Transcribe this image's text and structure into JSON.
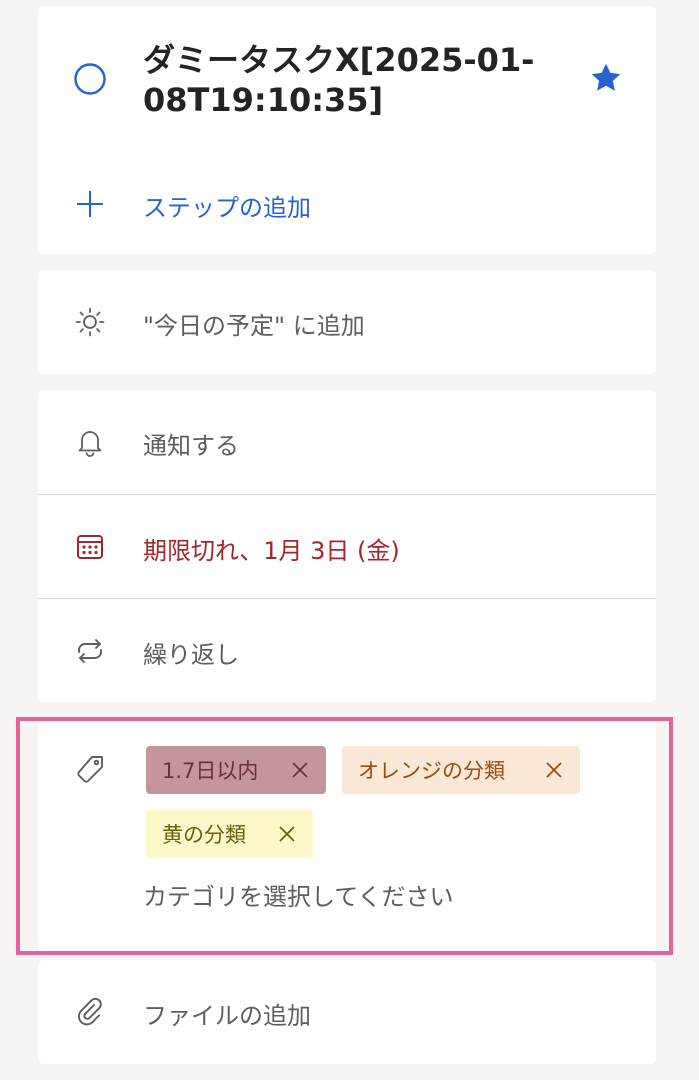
{
  "task": {
    "title": "ダミータスクX[2025-01-08T19:10:35]",
    "title_line1": "ダミータスクX[2025-01-",
    "title_line2": "08T19:10:35]",
    "add_step_label": "ステップの追加"
  },
  "my_day": {
    "label": "\"今日の予定\" に追加"
  },
  "details": {
    "remind_label": "通知する",
    "due_label": "期限切れ、1月 3日 (金)",
    "repeat_label": "繰り返し"
  },
  "categories": {
    "chips": [
      {
        "label": "1.7日以内",
        "bg": "#c4959c",
        "fg": "#6b2f37"
      },
      {
        "label": "オレンジの分類",
        "bg": "#fbe8d6",
        "fg": "#a04a10"
      },
      {
        "label": "黄の分類",
        "bg": "#fdf8c8",
        "fg": "#6b5e10"
      }
    ],
    "placeholder": "カテゴリを選択してください"
  },
  "file": {
    "label": "ファイルの追加"
  },
  "colors": {
    "accent": "#2564cf",
    "overdue": "#a4262c",
    "muted_text": "#605e5c",
    "highlight": "#e8629a"
  }
}
